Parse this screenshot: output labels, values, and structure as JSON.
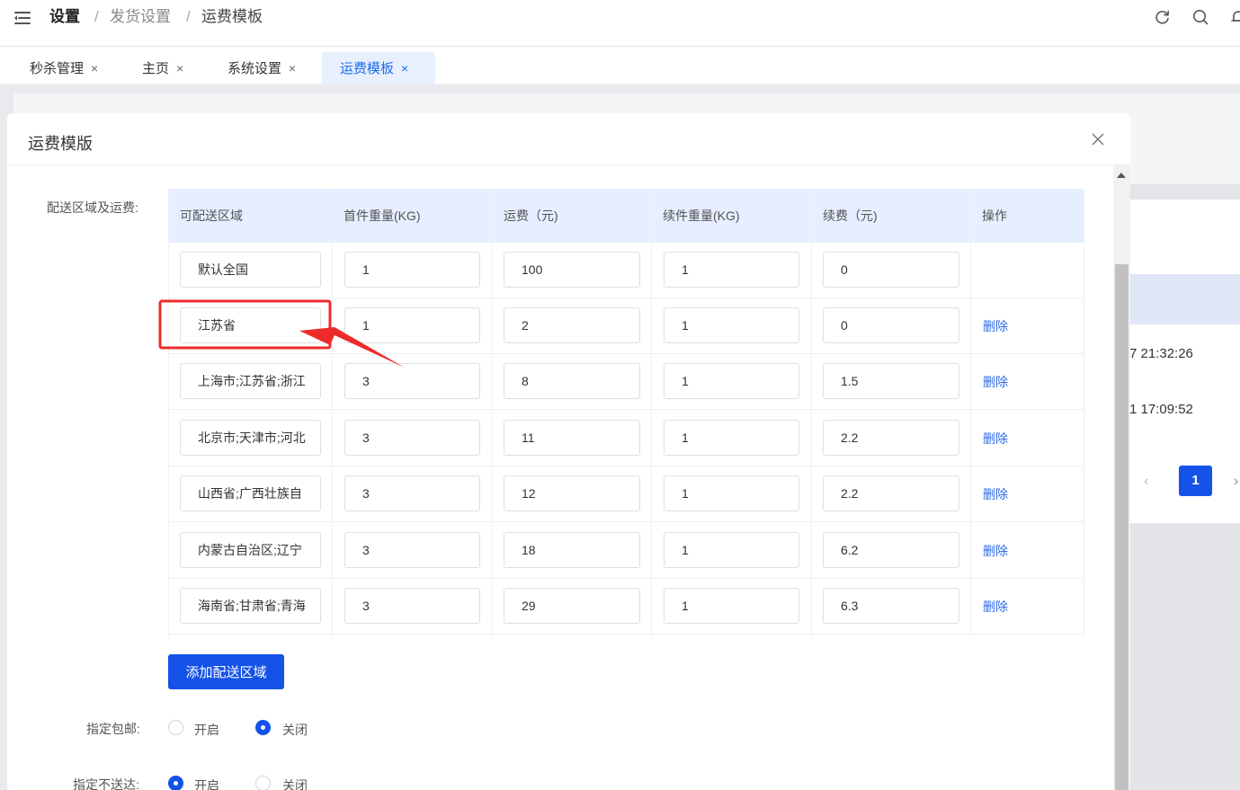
{
  "header": {
    "breadcrumbs": [
      "设置",
      "发货设置",
      "运费模板"
    ],
    "separator": "/"
  },
  "tabs": [
    {
      "label": "秒杀管理",
      "active": false
    },
    {
      "label": "主页",
      "active": false
    },
    {
      "label": "系统设置",
      "active": false
    },
    {
      "label": "运费模板",
      "active": true
    }
  ],
  "tab_close_glyph": "×",
  "background_page": {
    "times": [
      "7 21:32:26",
      "1 17:09:52"
    ],
    "pagination": {
      "prev": "‹",
      "current": "1",
      "next": "›"
    }
  },
  "modal": {
    "title": "运费模版",
    "close_icon": "close-icon",
    "section_label": "配送区域及运费:",
    "table": {
      "columns": [
        "可配送区域",
        "首件重量(KG)",
        "运费（元)",
        "续件重量(KG)",
        "续费（元)",
        "操作"
      ],
      "rows": [
        {
          "region": "默认全国",
          "first_weight": "1",
          "fee": "100",
          "extra_weight": "1",
          "extra_fee": "0",
          "action": ""
        },
        {
          "region": "江苏省",
          "first_weight": "1",
          "fee": "2",
          "extra_weight": "1",
          "extra_fee": "0",
          "action": "删除"
        },
        {
          "region": "上海市;江苏省;浙江",
          "first_weight": "3",
          "fee": "8",
          "extra_weight": "1",
          "extra_fee": "1.5",
          "action": "删除"
        },
        {
          "region": "北京市;天津市;河北",
          "first_weight": "3",
          "fee": "11",
          "extra_weight": "1",
          "extra_fee": "2.2",
          "action": "删除"
        },
        {
          "region": "山西省;广西壮族自",
          "first_weight": "3",
          "fee": "12",
          "extra_weight": "1",
          "extra_fee": "2.2",
          "action": "删除"
        },
        {
          "region": "内蒙古自治区;辽宁",
          "first_weight": "3",
          "fee": "18",
          "extra_weight": "1",
          "extra_fee": "6.2",
          "action": "删除"
        },
        {
          "region": "海南省;甘肃省;青海",
          "first_weight": "3",
          "fee": "29",
          "extra_weight": "1",
          "extra_fee": "6.3",
          "action": "删除"
        }
      ]
    },
    "add_button": "添加配送区域",
    "free_shipping": {
      "label": "指定包邮:",
      "options": [
        "开启",
        "关闭"
      ],
      "selected": "关闭"
    },
    "no_delivery": {
      "label": "指定不送达:",
      "options": [
        "开启",
        "关闭"
      ],
      "selected": "开启"
    }
  },
  "colors": {
    "primary": "#1552e8",
    "link": "#2d6be8",
    "highlight_box": "#ee2b2b",
    "table_header_bg": "#e6eeff"
  }
}
